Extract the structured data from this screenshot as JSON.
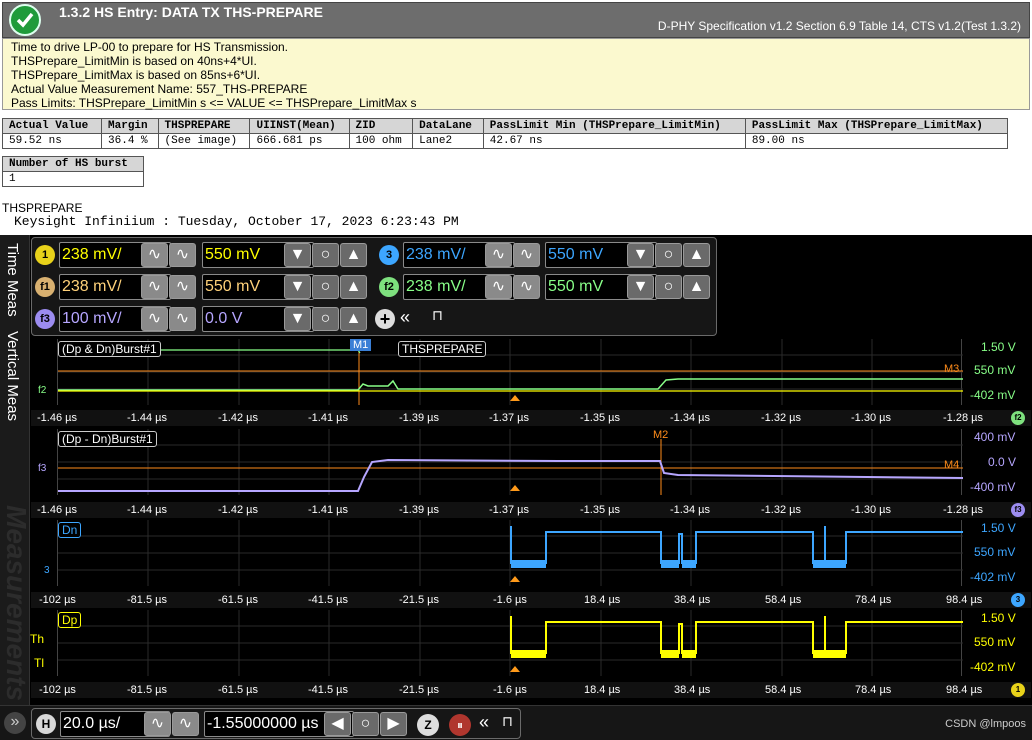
{
  "header": {
    "title": "1.3.2 HS Entry: DATA TX THS-PREPARE",
    "spec": "D-PHY Specification v1.2 Section 6.9 Table 14, CTS v1.2(Test 1.3.2)",
    "status_color": "#1f9b3a"
  },
  "description": [
    "Time to drive LP-00 to prepare for HS Transmission.",
    "THSPrepare_LimitMin is based on 40ns+4*UI.",
    "THSPrepare_LimitMax is based on 85ns+6*UI.",
    "Actual Value Measurement Name: 557_THS-PREPARE",
    "Pass Limits: THSPrepare_LimitMin s <= VALUE <= THSPrepare_LimitMax s"
  ],
  "results_table": {
    "headers": [
      "Actual Value",
      "Margin",
      "THSPREPARE",
      "UIINST(Mean)",
      "ZID",
      "DataLane",
      "PassLimit Min (THSPrepare_LimitMin)",
      "PassLimit Max (THSPrepare_LimitMax)"
    ],
    "row": [
      "59.52 ns",
      "36.4 %",
      "(See image)",
      "666.681 ps",
      "100 ohm",
      "Lane2",
      "42.67 ns",
      "89.00 ns"
    ]
  },
  "burst_table": {
    "header": "Number of HS burst",
    "value": "1"
  },
  "image_label": "THSPREPARE",
  "scope_caption": "Keysight Infiniium : Tuesday, October 17, 2023 6:23:43 PM",
  "scope": {
    "left_tabs": {
      "time": "Time Meas",
      "vertical": "Vertical Meas",
      "measurements": "Measurements"
    },
    "channels": [
      {
        "badge": "1",
        "scale": "238 mV/",
        "offset": "550 mV",
        "color": "#ffff00"
      },
      {
        "badge": "3",
        "scale": "238 mV/",
        "offset": "550 mV",
        "color": "#3da6ff"
      },
      {
        "badge": "f1",
        "scale": "238 mV/",
        "offset": "550 mV",
        "color": "#ffd27a"
      },
      {
        "badge": "f2",
        "scale": "238 mV/",
        "offset": "550 mV",
        "color": "#88ff88"
      },
      {
        "badge": "f3",
        "scale": "100 mV/",
        "offset": "0.0 V",
        "color": "#b6a6ff"
      }
    ],
    "pane1": {
      "tag": "(Dp & Dn)Burst#1",
      "marker": "M1",
      "meas_label": "THSPREPARE",
      "ref_marker": "M3",
      "right_labels": [
        "1.50 V",
        "550 mV",
        "-402 mV"
      ],
      "left_marker": "f2",
      "ticks": [
        "-1.46 µs",
        "-1.44 µs",
        "-1.42 µs",
        "-1.41 µs",
        "-1.39 µs",
        "-1.37 µs",
        "-1.35 µs",
        "-1.34 µs",
        "-1.32 µs",
        "-1.30 µs",
        "-1.28 µs"
      ],
      "corner": "f2"
    },
    "pane2": {
      "tag": "(Dp - Dn)Burst#1",
      "marker": "M2",
      "ref_marker": "M4",
      "right_labels": [
        "400 mV",
        "0.0 V",
        "-400 mV"
      ],
      "left_marker": "f3",
      "ticks": [
        "-1.46 µs",
        "-1.44 µs",
        "-1.42 µs",
        "-1.41 µs",
        "-1.39 µs",
        "-1.37 µs",
        "-1.35 µs",
        "-1.34 µs",
        "-1.32 µs",
        "-1.30 µs",
        "-1.28 µs"
      ],
      "corner": "f3"
    },
    "pane3": {
      "tag": "Dn",
      "right_labels": [
        "1.50 V",
        "550 mV",
        "-402 mV"
      ],
      "left_marker": "3",
      "ticks": [
        "-102 µs",
        "-81.5 µs",
        "-61.5 µs",
        "-41.5 µs",
        "-21.5 µs",
        "-1.6 µs",
        "18.4 µs",
        "38.4 µs",
        "58.4 µs",
        "78.4 µs",
        "98.4 µs"
      ],
      "corner": "3"
    },
    "pane4": {
      "tag": "Dp",
      "right_labels": [
        "1.50 V",
        "550 mV",
        "-402 mV"
      ],
      "left_markers": [
        "Th",
        "Tl"
      ],
      "ticks": [
        "-102 µs",
        "-81.5 µs",
        "-61.5 µs",
        "-41.5 µs",
        "-21.5 µs",
        "-1.6 µs",
        "18.4 µs",
        "38.4 µs",
        "58.4 µs",
        "78.4 µs",
        "98.4 µs"
      ],
      "corner": "1"
    },
    "bottom": {
      "h_badge": "H",
      "time_scale": "20.0 µs/",
      "position": "-1.55000000 µs",
      "watermark": "CSDN @lmpoos"
    }
  }
}
